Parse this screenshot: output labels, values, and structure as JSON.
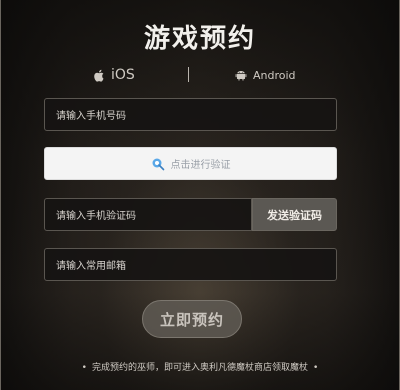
{
  "page": {
    "title": "游戏预约"
  },
  "platforms": {
    "ios": {
      "label": "iOS",
      "icon": "apple-icon"
    },
    "android": {
      "label": "Android",
      "icon": "android-icon"
    }
  },
  "form": {
    "phone": {
      "placeholder": "请输入手机号码"
    },
    "verify": {
      "label": "点击进行验证",
      "icon": "captcha-icon"
    },
    "code": {
      "placeholder": "请输入手机验证码"
    },
    "send_code_button": "发送验证码",
    "email": {
      "placeholder": "请输入常用邮箱"
    },
    "submit_button": "立即预约"
  },
  "footer": {
    "bullet": "•",
    "note": "完成预约的巫师，即可进入奥利凡德魔杖商店领取魔杖"
  },
  "colors": {
    "background": "#1c1a18",
    "field_bg": "#161412",
    "send_button_bg": "#5b5853",
    "submit_bg": "#5f5a54",
    "verify_bg": "#f4f4f4"
  }
}
